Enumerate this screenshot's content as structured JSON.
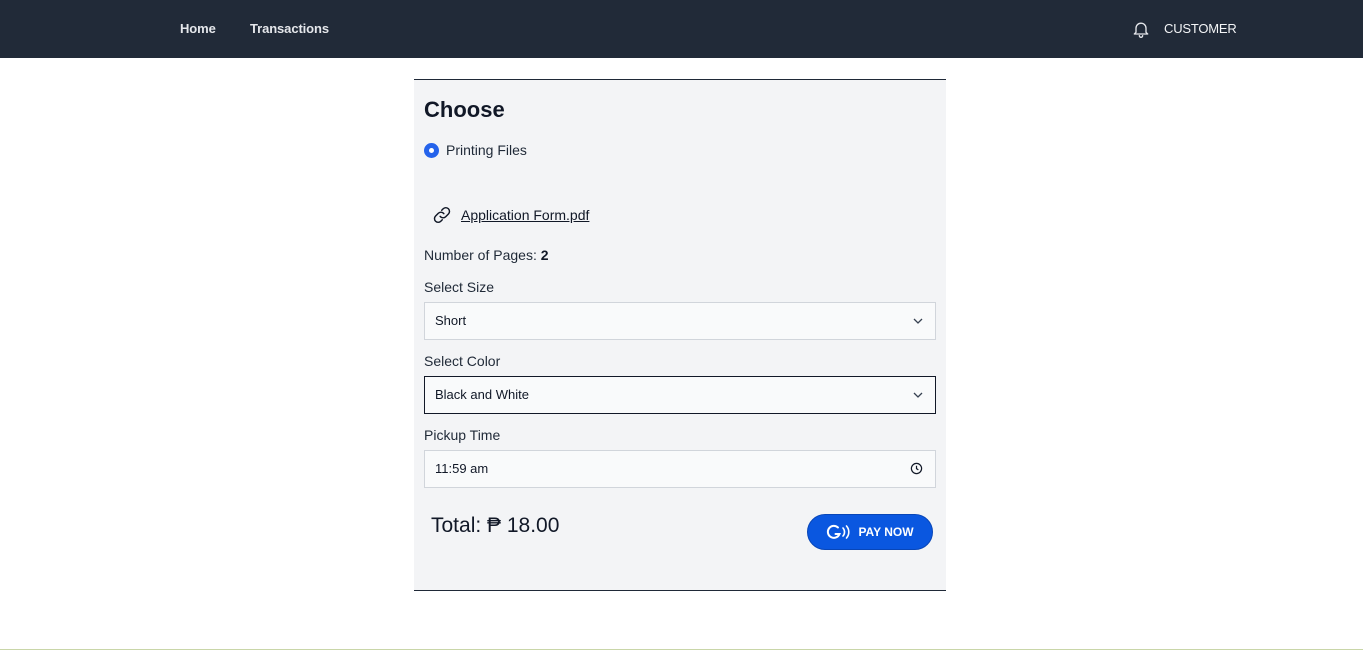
{
  "nav": {
    "home": "Home",
    "transactions": "Transactions",
    "user": "CUSTOMER",
    "bell_icon": "bell-icon"
  },
  "card": {
    "title": "Choose",
    "option": {
      "label": "Printing Files",
      "selected": true
    },
    "file": {
      "name": "Application Form.pdf",
      "icon": "link-icon"
    },
    "pages": {
      "label": "Number of Pages:",
      "value": "2"
    },
    "size": {
      "label": "Select Size",
      "value": "Short"
    },
    "color": {
      "label": "Select Color",
      "value": "Black and White"
    },
    "pickup": {
      "label": "Pickup Time",
      "value": "11:59 am"
    },
    "total": "Total: ₱ 18.00",
    "pay_button": {
      "label": "PAY NOW",
      "icon": "gcash-icon"
    }
  },
  "colors": {
    "nav_bg": "#212a38",
    "card_bg": "#f3f4f6",
    "accent": "#2563eb",
    "pay_bg": "#0a57e0"
  }
}
